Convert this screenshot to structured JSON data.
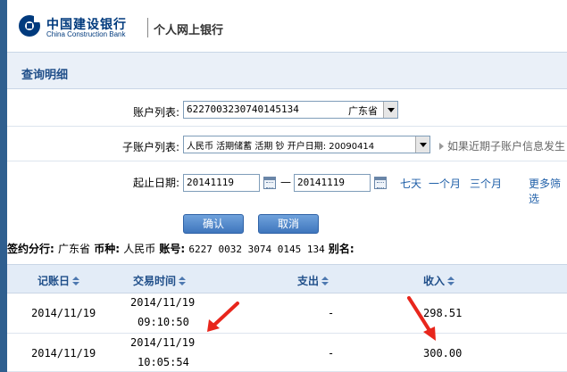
{
  "header": {
    "bank_name_cn": "中国建设银行",
    "bank_name_en": "China Construction Bank",
    "product": "个人网上银行"
  },
  "page": {
    "title": "查询明细"
  },
  "form": {
    "account_label": "账户列表:",
    "account_value": "6227003230740145134",
    "account_region": "广东省",
    "subaccount_label": "子账户列表:",
    "subaccount_value": "人民币 活期储蓄 活期 钞 开户日期: 20090414",
    "subaccount_hint": "如果近期子账户信息发生",
    "date_label": "起止日期:",
    "start_date": "20141119",
    "end_date": "20141119",
    "date_dash": "—",
    "quick_links": [
      "七天",
      "一个月",
      "三个月"
    ],
    "more_filter": "更多筛选"
  },
  "buttons": {
    "confirm": "确认",
    "cancel": "取消"
  },
  "sign_info": {
    "branch_label": "签约分行:",
    "branch_value": "广东省",
    "currency_label": "币种:",
    "currency_value": "人民币",
    "account_label": "账号:",
    "account_value": "6227 0032 3074 0145 134",
    "alias_label": "别名:"
  },
  "table": {
    "headers": [
      "记账日",
      "交易时间",
      "支出",
      "收入"
    ],
    "rows": [
      {
        "date": "2014/11/19",
        "time_date": "2014/11/19",
        "time_clock": "09:10:50",
        "expense": "-",
        "income": "298.51"
      },
      {
        "date": "2014/11/19",
        "time_date": "2014/11/19",
        "time_clock": "10:05:54",
        "expense": "-",
        "income": "300.00"
      }
    ]
  },
  "colors": {
    "brand_blue": "#003a7d",
    "title_blue": "#1f4e89",
    "link_blue": "#1f5fa8",
    "annotation_red": "#e8261c"
  }
}
